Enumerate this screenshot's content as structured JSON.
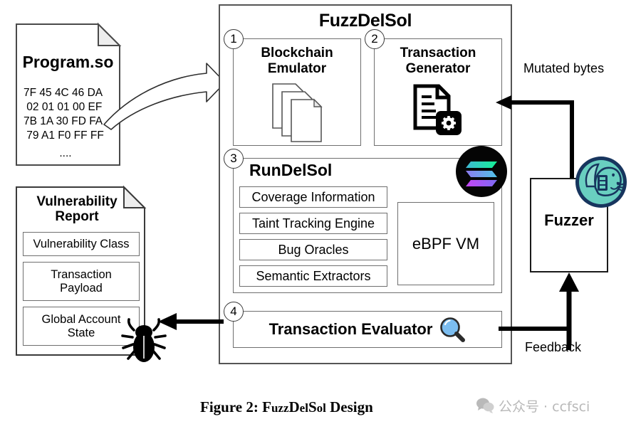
{
  "figure": {
    "caption_prefix": "Figure 2: ",
    "caption_name_a": "F",
    "caption_name_b": "uzz",
    "caption_name_c": "D",
    "caption_name_d": "el",
    "caption_name_e": "S",
    "caption_name_f": "ol",
    "caption_suffix": " Design",
    "watermark": "公众号 · ccfsci"
  },
  "program_file": {
    "title": "Program.so",
    "hex_dump": "7F 45 4C 46 DA\n 02 01 01 00 EF\n7B 1A 30 FD FA\n 79 A1 F0 FF FF",
    "ellipsis": "...."
  },
  "fuzzdelsol": {
    "title": "FuzzDelSol",
    "blockchain_emulator": {
      "number": "1",
      "label_line1": "Blockchain",
      "label_line2": "Emulator",
      "icon": "stacked-documents-icon"
    },
    "transaction_generator": {
      "number": "2",
      "label_line1": "Transaction",
      "label_line2": "Generator",
      "icon": "document-gear-icon"
    },
    "rundelsol": {
      "number": "3",
      "title": "RunDelSol",
      "logo": "solana-logo",
      "items": [
        "Coverage Information",
        "Taint Tracking Engine",
        "Bug Oracles",
        "Semantic Extractors"
      ],
      "vm_label": "eBPF VM"
    },
    "transaction_evaluator": {
      "number": "4",
      "label": "Transaction Evaluator",
      "icon": "magnifier-icon"
    }
  },
  "fuzzer": {
    "label": "Fuzzer",
    "logo": "afl-rabbit-icon"
  },
  "vulnerability_report": {
    "title_line1": "Vulnerability",
    "title_line2": "Report",
    "items": [
      {
        "line1": "Vulnerability Class",
        "line2": ""
      },
      {
        "line1": "Transaction",
        "line2": "Payload"
      },
      {
        "line1": "Global Account",
        "line2": "State"
      }
    ],
    "icon": "bug-icon"
  },
  "arrows": {
    "mutated_bytes": "Mutated bytes",
    "feedback": "Feedback",
    "program_to_system": "curved-block-arrow",
    "evaluator_to_report": "left-arrow",
    "feedback_to_fuzzer": "up-arrow"
  },
  "colors": {
    "magnifier_lens": "#7BBDF0",
    "magnifier_rim": "#2b2b2b",
    "solana_black": "#030303",
    "solana_teal": "#14F195",
    "solana_cyan": "#3fc6d4",
    "solana_purple": "#9945FF",
    "afl_teal": "#69CFC0",
    "afl_navy": "#17355E",
    "box_border": "#6f6f6f",
    "outer_border": "#4a4a4a",
    "watermark": "#b9b9b9"
  }
}
